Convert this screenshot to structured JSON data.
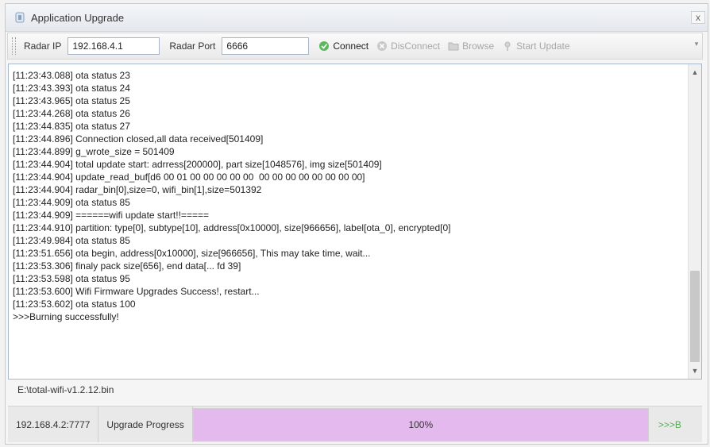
{
  "window": {
    "title": "Application Upgrade",
    "close_label": "x"
  },
  "toolbar": {
    "radar_ip_label": "Radar IP",
    "radar_ip_value": "192.168.4.1",
    "radar_port_label": "Radar Port",
    "radar_port_value": "6666",
    "connect_label": "Connect",
    "disconnect_label": "DisConnect",
    "browse_label": "Browse",
    "start_update_label": "Start Update"
  },
  "log": {
    "lines": [
      "[11:23:43.088] ota status 23",
      "[11:23:43.393] ota status 24",
      "[11:23:43.965] ota status 25",
      "[11:23:44.268] ota status 26",
      "[11:23:44.835] ota status 27",
      "[11:23:44.896] Connection closed,all data received[501409]",
      "[11:23:44.899] g_wrote_size = 501409",
      "[11:23:44.904] total update start: adrress[200000], part size[1048576], img size[501409]",
      "[11:23:44.904] update_read_buf[d6 00 01 00 00 00 00 00  00 00 00 00 00 00 00 00]",
      "[11:23:44.904] radar_bin[0],size=0, wifi_bin[1],size=501392",
      "[11:23:44.909] ota status 85",
      "[11:23:44.909] ======wifi update start!!=====",
      "[11:23:44.910] partition: type[0], subtype[10], address[0x10000], size[966656], label[ota_0], encrypted[0]",
      "[11:23:49.984] ota status 85",
      "[11:23:51.656] ota begin, address[0x10000], size[966656], This may take time, wait...",
      "[11:23:53.306] finaly pack size[656], end data[... fd 39]",
      "[11:23:53.598] ota status 95",
      "[11:23:53.600] Wifi Firmware Upgrades Success!, restart...",
      "[11:23:53.602] ota status 100",
      ">>>Burning successfully!"
    ]
  },
  "file_path": "E:\\total-wifi-v1.2.12.bin",
  "status": {
    "address": "192.168.4.2:7777",
    "progress_label": "Upgrade Progress",
    "progress_value": 1.0,
    "progress_text": "100%",
    "tail_text": ">>>B"
  },
  "colors": {
    "progress_fill": "#e4b9ee",
    "connect_icon": "#5cb85c",
    "tail_text": "#4cb04c"
  }
}
